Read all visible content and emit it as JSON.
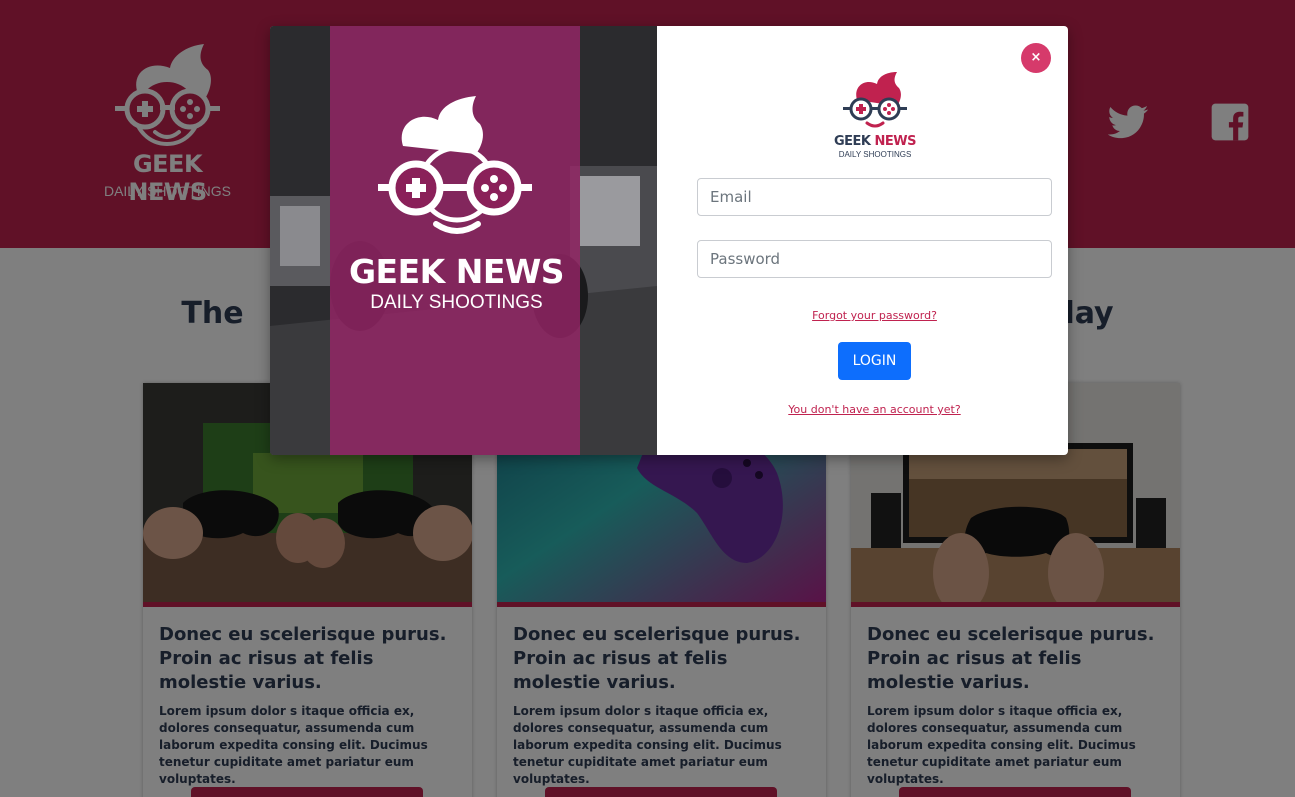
{
  "brand": {
    "title": "GEEK NEWS",
    "title_part1": "GEEK ",
    "title_part2": "NEWS",
    "subtitle": "DAILY SHOOTINGS"
  },
  "header": {
    "social": [
      {
        "icon": "twitter-icon"
      },
      {
        "icon": "facebook-icon"
      }
    ]
  },
  "main": {
    "heading_left": "The",
    "heading_right": "lay",
    "cards": [
      {
        "image": "gamepads-in-hands-photo",
        "title": "Donec eu scelerisque purus. Proin ac risus at felis molestie varius.",
        "text": "Lorem ipsum dolor s itaque officia ex, dolores consequatur, assumenda cum laborum expedita consing elit. Ducimus tenetur cupiditate amet pariatur eum voluptates."
      },
      {
        "image": "purple-controller-photo",
        "title": "Donec eu scelerisque purus. Proin ac risus at felis molestie varius.",
        "text": "Lorem ipsum dolor s itaque officia ex, dolores consequatur, assumenda cum laborum expedita consing elit. Ducimus tenetur cupiditate amet pariatur eum voluptates."
      },
      {
        "image": "xbox-controller-photo",
        "title": "Donec eu scelerisque purus. Proin ac risus at felis molestie varius.",
        "text": "Lorem ipsum dolor s itaque officia ex, dolores consequatur, assumenda cum laborum expedita consing elit. Ducimus tenetur cupiditate amet pariatur eum voluptates."
      }
    ]
  },
  "modal": {
    "close_icon": "close-icon",
    "close_label": "×",
    "email_placeholder": "Email",
    "password_placeholder": "Password",
    "forgot_label": "Forgot your password?",
    "login_label": "LOGIN",
    "signup_label": "You don't have an account yet?"
  },
  "colors": {
    "brand": "#c0224f",
    "dark_text": "#2f3d55",
    "primary_button": "#0d6efd",
    "close_button": "#d63a6b"
  }
}
